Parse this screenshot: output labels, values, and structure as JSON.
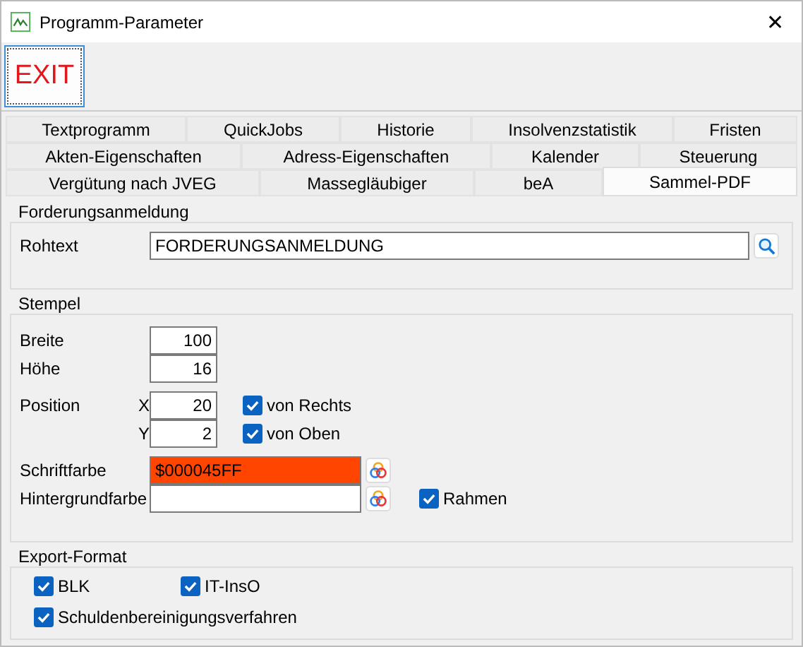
{
  "window": {
    "title": "Programm-Parameter",
    "close": "✕"
  },
  "toolbar": {
    "exit": "EXIT"
  },
  "tab_rows": [
    [
      {
        "label": "Textprogramm",
        "selected": false
      },
      {
        "label": "QuickJobs",
        "selected": false
      },
      {
        "label": "Historie",
        "selected": false
      },
      {
        "label": "Insolvenzstatistik",
        "selected": false
      },
      {
        "label": "Fristen",
        "selected": false
      }
    ],
    [
      {
        "label": "Akten-Eigenschaften",
        "selected": false
      },
      {
        "label": "Adress-Eigenschaften",
        "selected": false
      },
      {
        "label": "Kalender",
        "selected": false
      },
      {
        "label": "Steuerung",
        "selected": false
      }
    ],
    [
      {
        "label": "Vergütung nach JVEG",
        "selected": false
      },
      {
        "label": "Massegläubiger",
        "selected": false
      },
      {
        "label": "beA",
        "selected": false
      },
      {
        "label": "Sammel-PDF",
        "selected": true
      }
    ]
  ],
  "forderungsanmeldung": {
    "title": "Forderungsanmeldung",
    "label": "Rohtext",
    "value": "FORDERUNGSANMELDUNG"
  },
  "stempel": {
    "title": "Stempel",
    "size_fields": [
      {
        "label": "Breite",
        "value": "100"
      },
      {
        "label": "Höhe",
        "value": "16"
      }
    ],
    "position": {
      "label": "Position",
      "rows": [
        {
          "axis": "X",
          "value": "20",
          "option": "von Rechts",
          "checked": true
        },
        {
          "axis": "Y",
          "value": "2",
          "option": "von Oben",
          "checked": true
        }
      ]
    },
    "colors": [
      {
        "label": "Schriftfarbe",
        "value": "$000045FF",
        "color": "#ff4500"
      },
      {
        "label": "Hintergrundfarbe",
        "color": "#ffffff"
      }
    ],
    "frame": {
      "label": "Rahmen",
      "checked": true
    }
  },
  "export": {
    "title": "Export-Format",
    "options": [
      {
        "label": "BLK",
        "checked": true
      },
      {
        "label": "IT-InsO",
        "checked": true
      },
      {
        "label": "Schuldenbereinigungsverfahren",
        "checked": true
      }
    ]
  }
}
